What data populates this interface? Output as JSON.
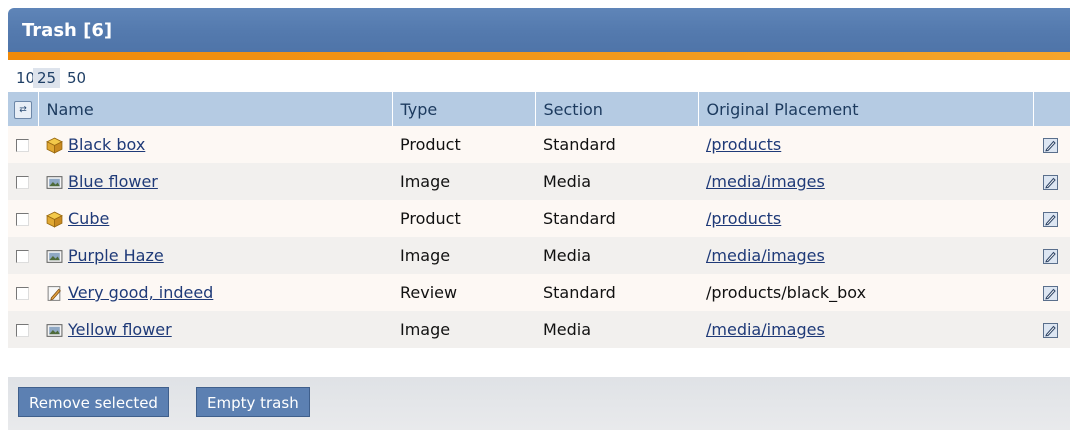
{
  "window": {
    "title": "Trash [6]"
  },
  "limits": {
    "options": [
      "10",
      "25",
      "50"
    ],
    "selected": "25"
  },
  "table": {
    "columns": [
      "Name",
      "Type",
      "Section",
      "Original Placement"
    ],
    "rows": [
      {
        "name": "Black box",
        "icon": "product-icon",
        "type": "Product",
        "section": "Standard",
        "placement": "/products",
        "placement_link": true
      },
      {
        "name": "Blue flower",
        "icon": "image-icon",
        "type": "Image",
        "section": "Media",
        "placement": "/media/images",
        "placement_link": true
      },
      {
        "name": "Cube",
        "icon": "product-icon",
        "type": "Product",
        "section": "Standard",
        "placement": "/products",
        "placement_link": true
      },
      {
        "name": "Purple Haze",
        "icon": "image-icon",
        "type": "Image",
        "section": "Media",
        "placement": "/media/images",
        "placement_link": true
      },
      {
        "name": "Very good, indeed",
        "icon": "review-icon",
        "type": "Review",
        "section": "Standard",
        "placement": "/products/black_box",
        "placement_link": false
      },
      {
        "name": "Yellow flower",
        "icon": "image-icon",
        "type": "Image",
        "section": "Media",
        "placement": "/media/images",
        "placement_link": true
      }
    ]
  },
  "buttons": {
    "remove_selected": "Remove selected",
    "empty_trash": "Empty trash"
  },
  "colors": {
    "header": "#547aae",
    "accent_bar": "#f39a1c",
    "column_header": "#b5cbe3",
    "button": "#5c80b2"
  }
}
